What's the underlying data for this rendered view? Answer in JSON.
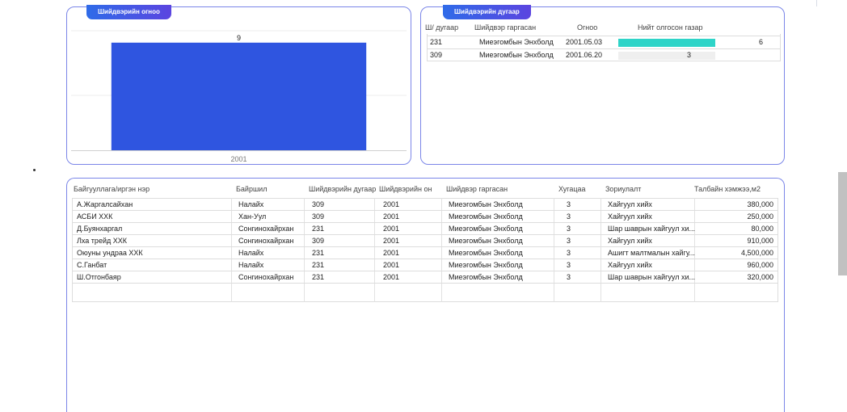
{
  "chart_panel": {
    "title": "Шийдвэрийн огноо"
  },
  "chart_data": {
    "type": "bar",
    "categories": [
      "2001"
    ],
    "values": [
      9
    ],
    "ylim": [
      0,
      10
    ],
    "grid": true,
    "bar_color": "#2f55e0"
  },
  "detail_panel": {
    "title": "Шийдвэрийн дугаар",
    "columns": [
      "Ш/ дугаар",
      "Шийдвэр гаргасан",
      "Огноо",
      "Нийт олгосон газар"
    ],
    "rows": [
      {
        "number": "231",
        "issuer": "Миеэгомбын Энхболд",
        "date": "2001.05.03",
        "count": "6",
        "fill": 1.0
      },
      {
        "number": "309",
        "issuer": "Миеэгомбын Энхболд",
        "date": "2001.06.20",
        "count": "3",
        "fill": 0.73
      }
    ],
    "bar_color": "#2fd4c8"
  },
  "table_panel": {
    "columns": [
      "Байгууллага/иргэн нэр",
      "Байршил",
      "Шийдвэрийн дугаар",
      "Шийдвэрийн он",
      "Шийдвэр гаргасан",
      "Хугацаа",
      "Зориулалт",
      "Талбайн хэмжээ,м2"
    ],
    "rows": [
      [
        "А.Жаргалсайхан",
        "Налайх",
        "309",
        "2001",
        "Миеэгомбын Энхболд",
        "3",
        "Хайгуул хийх",
        "380,000"
      ],
      [
        "АСБИ ХХК",
        "Хан-Уул",
        "309",
        "2001",
        "Миеэгомбын Энхболд",
        "3",
        "Хайгуул хийх",
        "250,000"
      ],
      [
        "Д.Буянхаргал",
        "Сонгинохайрхан",
        "231",
        "2001",
        "Миеэгомбын Энхболд",
        "3",
        "Шар шаврын хайгуул хи...",
        "80,000"
      ],
      [
        "Лха трейд ХХК",
        "Сонгинохайрхан",
        "309",
        "2001",
        "Миеэгомбын Энхболд",
        "3",
        "Хайгуул хийх",
        "910,000"
      ],
      [
        "Оюуны ундраа ХХК",
        "Налайх",
        "231",
        "2001",
        "Миеэгомбын Энхболд",
        "3",
        "Ашигт малтмалын хайгу...",
        "4,500,000"
      ],
      [
        "С.Ганбат",
        "Налайх",
        "231",
        "2001",
        "Миеэгомбын Энхболд",
        "3",
        "Хайгуул хийх",
        "960,000"
      ],
      [
        "Ш.Отгонбаяр",
        "Сонгинохайрхан",
        "231",
        "2001",
        "Миеэгомбын Энхболд",
        "3",
        "Шар шаврын хайгуул хи...",
        "320,000"
      ]
    ]
  }
}
